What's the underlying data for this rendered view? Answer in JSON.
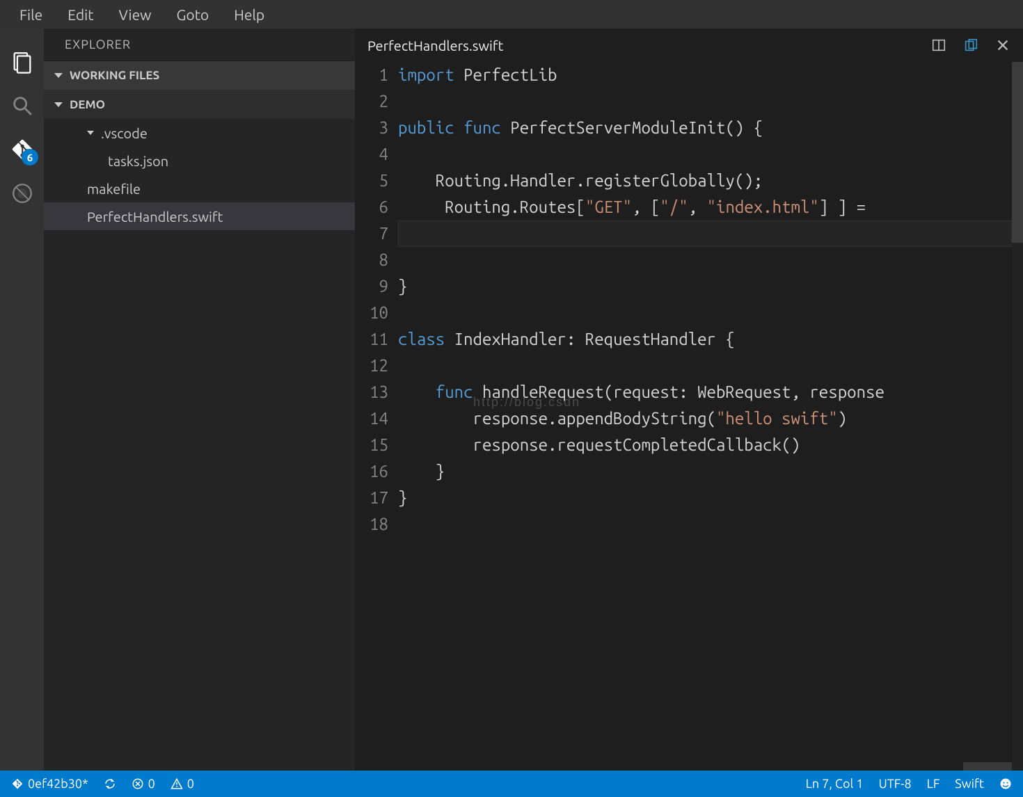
{
  "menubar": [
    "File",
    "Edit",
    "View",
    "Goto",
    "Help"
  ],
  "sidebar": {
    "title": "EXPLORER",
    "section1": "WORKING FILES",
    "section2": "DEMO",
    "tree": [
      {
        "type": "folder",
        "label": ".vscode",
        "indent": 1
      },
      {
        "type": "file",
        "label": "tasks.json",
        "indent": 2
      },
      {
        "type": "file",
        "label": "makefile",
        "indent": 1
      },
      {
        "type": "file",
        "label": "PerfectHandlers.swift",
        "indent": 1,
        "selected": true
      }
    ]
  },
  "activity_badge": "6",
  "editor": {
    "tab": "PerfectHandlers.swift",
    "lines": [
      [
        [
          "kw",
          "import"
        ],
        [
          "plain",
          " PerfectLib"
        ]
      ],
      [],
      [
        [
          "kw",
          "public"
        ],
        [
          "plain",
          " "
        ],
        [
          "kw",
          "func"
        ],
        [
          "plain",
          " PerfectServerModuleInit() {"
        ]
      ],
      [],
      [
        [
          "plain",
          "    Routing.Handler.registerGlobally();"
        ]
      ],
      [
        [
          "plain",
          "     Routing.Routes["
        ],
        [
          "str",
          "\"GET\""
        ],
        [
          "plain",
          ", ["
        ],
        [
          "str",
          "\"/\""
        ],
        [
          "plain",
          ", "
        ],
        [
          "str",
          "\"index.html\""
        ],
        [
          "plain",
          "] ] ="
        ]
      ],
      [
        [
          "plain",
          "    "
        ]
      ],
      [],
      [
        [
          "plain",
          "}"
        ]
      ],
      [],
      [
        [
          "kw",
          "class"
        ],
        [
          "plain",
          " IndexHandler: RequestHandler {"
        ]
      ],
      [],
      [
        [
          "plain",
          "    "
        ],
        [
          "kw",
          "func"
        ],
        [
          "plain",
          " handleRequest(request: WebRequest, response"
        ]
      ],
      [
        [
          "plain",
          "        response.appendBodyString("
        ],
        [
          "str",
          "\"hello swift\""
        ],
        [
          "plain",
          ")"
        ]
      ],
      [
        [
          "plain",
          "        response.requestCompletedCallback()"
        ]
      ],
      [
        [
          "plain",
          "    }"
        ]
      ],
      [
        [
          "plain",
          "}"
        ]
      ],
      []
    ],
    "highlight_line": 7,
    "watermark": "http://blog.csdn"
  },
  "statusbar": {
    "branch": "0ef42b30*",
    "errors": "0",
    "warnings": "0",
    "position": "Ln 7, Col 1",
    "encoding": "UTF-8",
    "eol": "LF",
    "language": "Swift"
  }
}
